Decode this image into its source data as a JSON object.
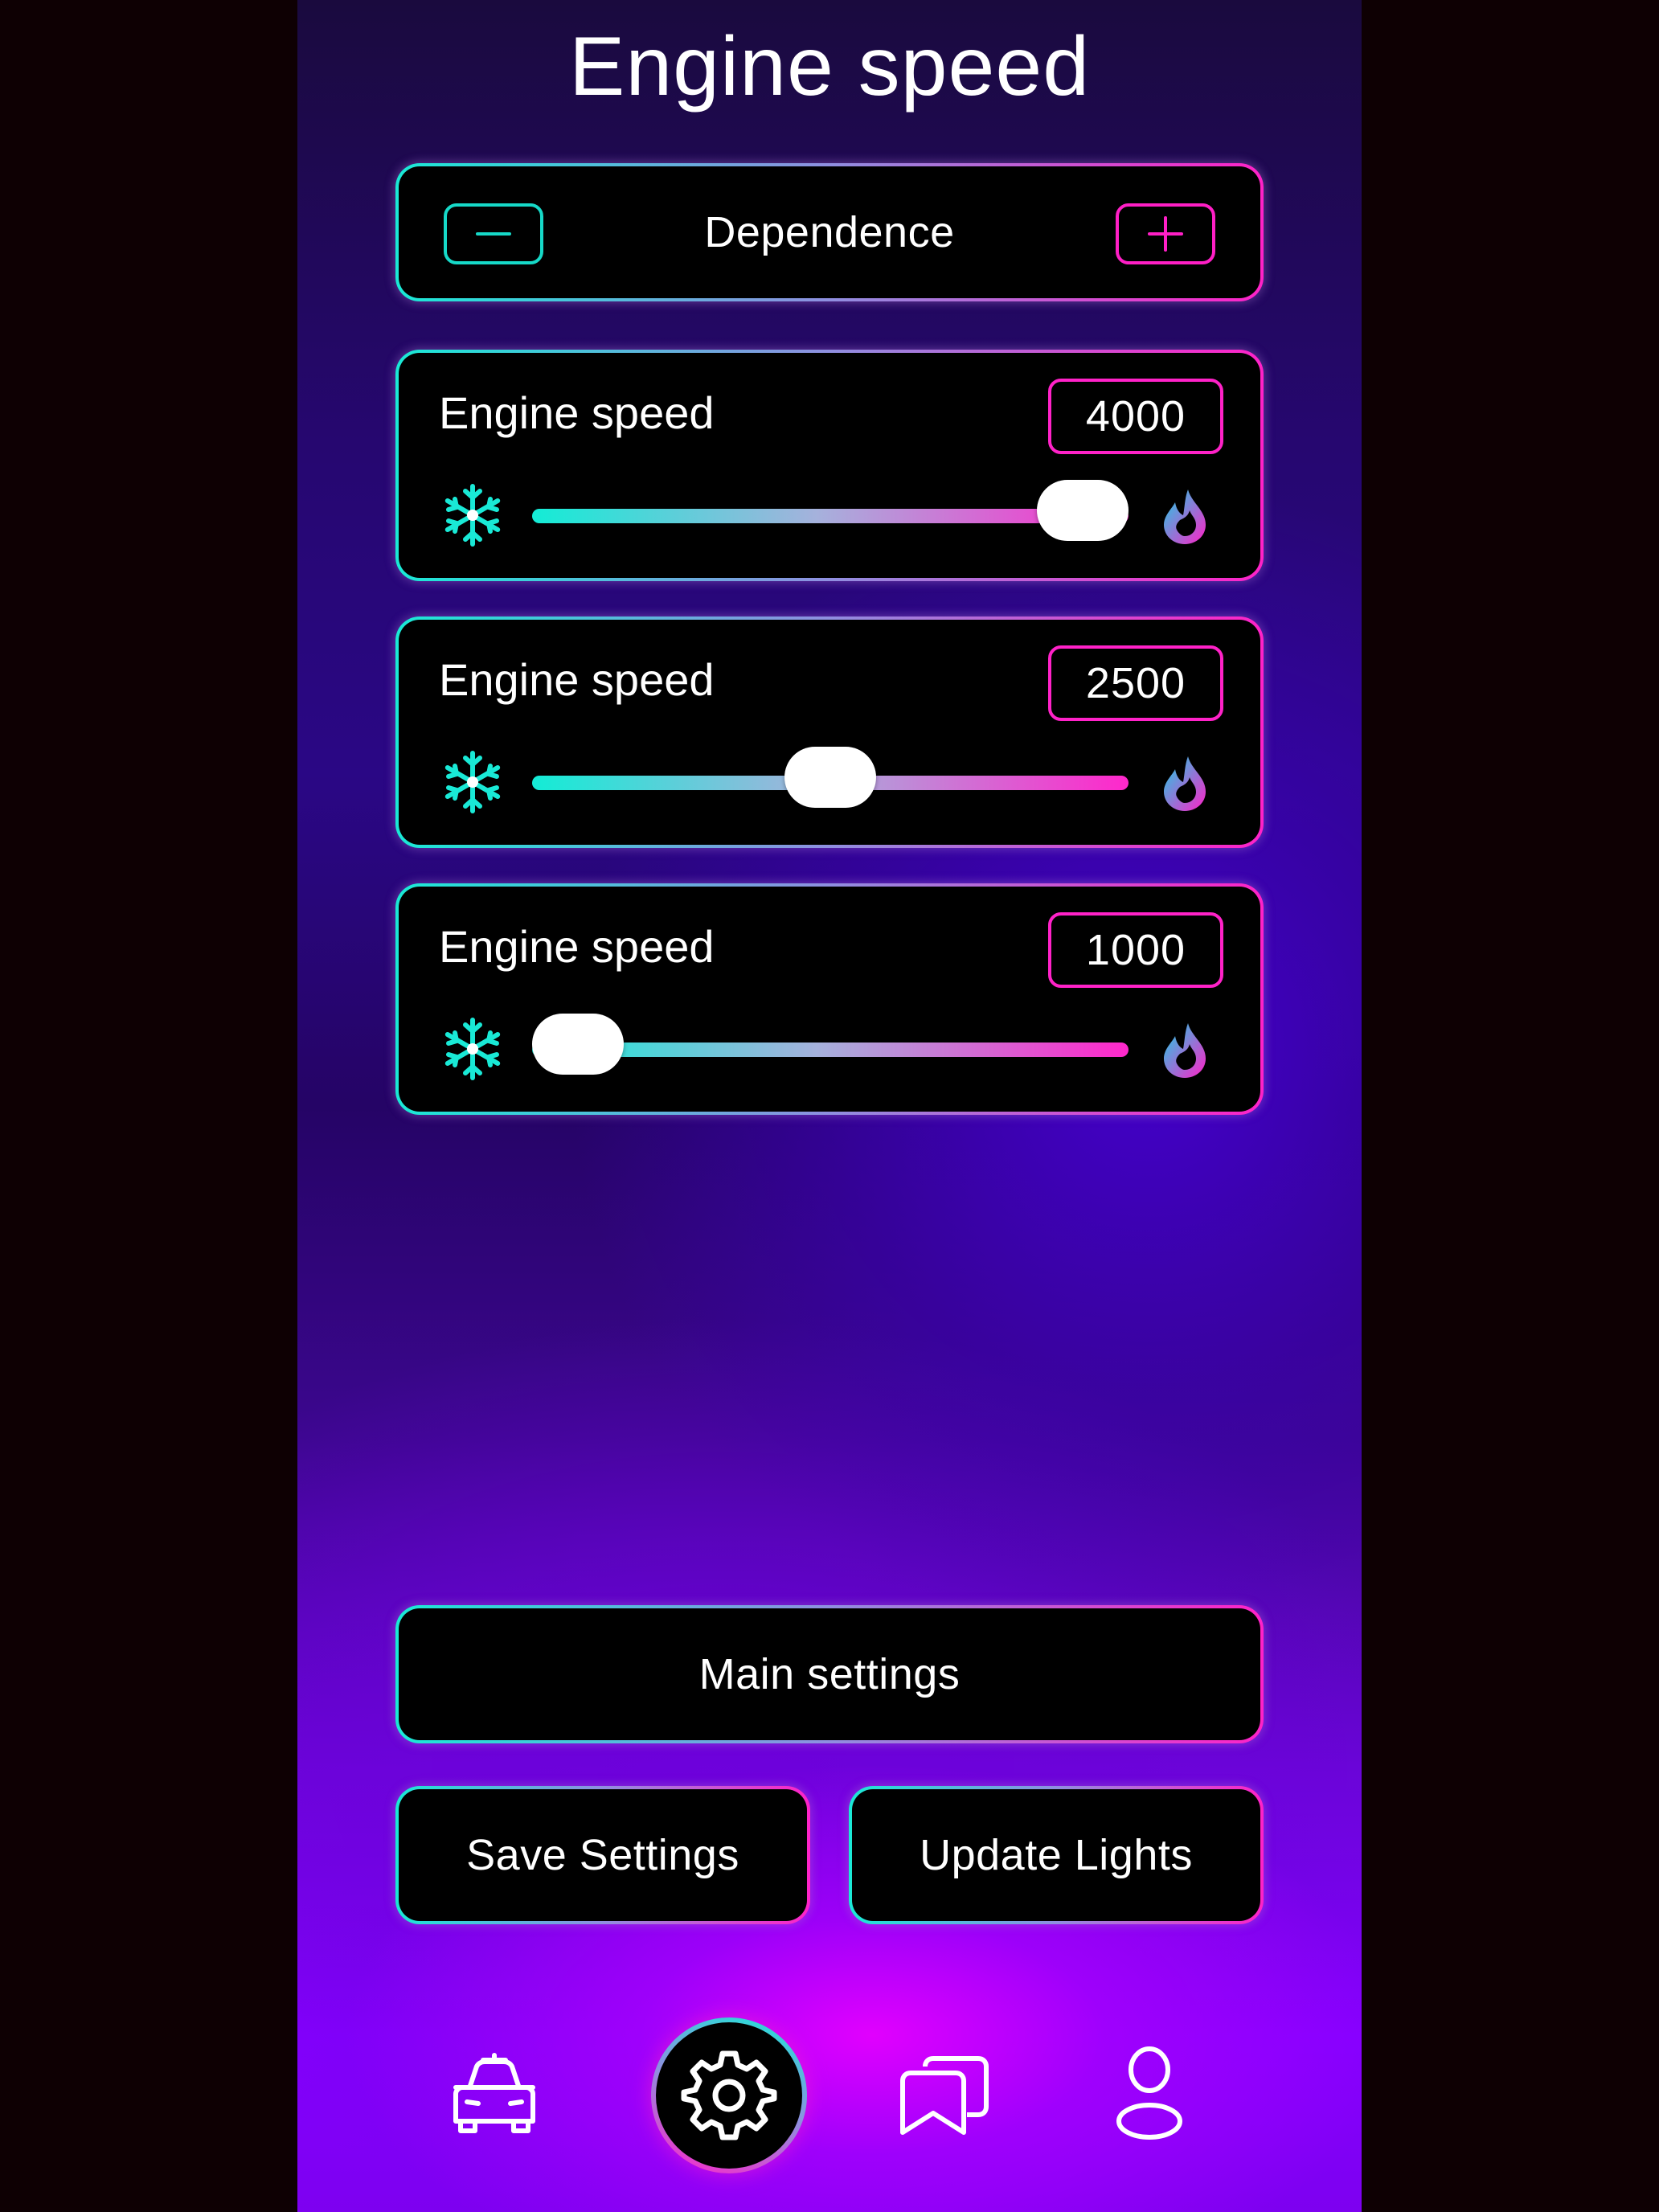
{
  "page": {
    "title": "Engine speed"
  },
  "dependence": {
    "label": "Dependence",
    "minus_symbol": "−",
    "plus_symbol": "+"
  },
  "sliders": [
    {
      "label": "Engine speed",
      "value": "4000",
      "position": 1.0
    },
    {
      "label": "Engine speed",
      "value": "2500",
      "position": 0.5
    },
    {
      "label": "Engine speed",
      "value": "1000",
      "position": 0.0
    }
  ],
  "buttons": {
    "main_settings": "Main settings",
    "save_settings": "Save Settings",
    "update_lights": "Update Lights"
  },
  "nav": {
    "items": [
      "car-icon",
      "gear-icon",
      "book-icon",
      "user-icon"
    ],
    "active": "gear-icon"
  },
  "colors": {
    "cyan": "#19e9d6",
    "magenta": "#ff22c8",
    "purple_bg": "#8400ff"
  }
}
